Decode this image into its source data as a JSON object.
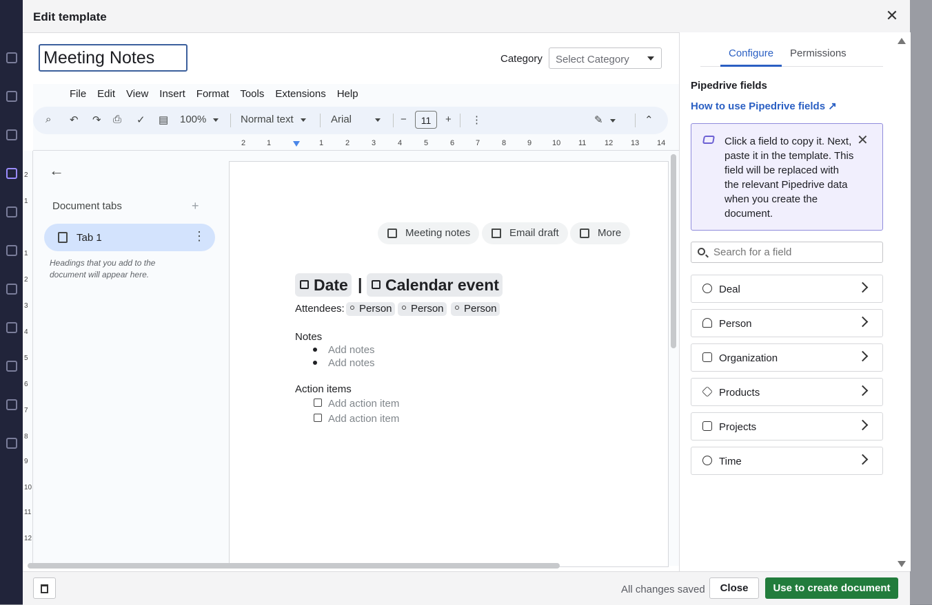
{
  "modal": {
    "title": "Edit template",
    "template_name": "Meeting Notes",
    "category_label": "Category",
    "category_placeholder": "Select Category"
  },
  "docs": {
    "menu": [
      "File",
      "Edit",
      "View",
      "Insert",
      "Format",
      "Tools",
      "Extensions",
      "Help"
    ],
    "toolbar": {
      "zoom": "100%",
      "style": "Normal text",
      "font": "Arial",
      "font_size": "11",
      "minus": "−",
      "plus": "+"
    },
    "ruler_numbers": [
      "2",
      "1",
      "1",
      "2",
      "3",
      "4",
      "5",
      "6",
      "7",
      "8",
      "9",
      "10",
      "11",
      "12",
      "13",
      "14"
    ],
    "vruler_numbers": [
      "2",
      "1",
      "1",
      "2",
      "3",
      "4",
      "5",
      "6",
      "7",
      "8",
      "9",
      "10",
      "11",
      "12"
    ],
    "sidebar": {
      "title": "Document tabs",
      "tab_label": "Tab 1",
      "hint": "Headings that you add to the document will appear here."
    },
    "chips": [
      "Meeting notes",
      "Email draft",
      "More"
    ],
    "body": {
      "date_chip": "Date",
      "separator": "|",
      "event_chip": "Calendar event",
      "attendees_label": "Attendees:",
      "people": [
        "Person",
        "Person",
        "Person"
      ],
      "notes_heading": "Notes",
      "notes_placeholders": [
        "Add notes",
        "Add notes"
      ],
      "actions_heading": "Action items",
      "action_placeholders": [
        "Add action item",
        "Add action item"
      ]
    }
  },
  "panel": {
    "tabs": [
      "Configure",
      "Permissions"
    ],
    "fields_title": "Pipedrive fields",
    "how_to_link": "How to use Pipedrive fields ↗",
    "info_text": "Click a field to copy it. Next, paste it in the template. This field will be replaced with the relevant Pipedrive data when you create the document.",
    "search_placeholder": "Search for a field",
    "fields": [
      "Deal",
      "Person",
      "Organization",
      "Products",
      "Projects",
      "Time"
    ]
  },
  "footer": {
    "status": "All changes saved",
    "close_label": "Close",
    "primary_label": "Use to create document"
  },
  "colors": {
    "accent_blue": "#2a5fc3",
    "primary_green": "#227c3c",
    "info_bg": "#f1effd"
  }
}
